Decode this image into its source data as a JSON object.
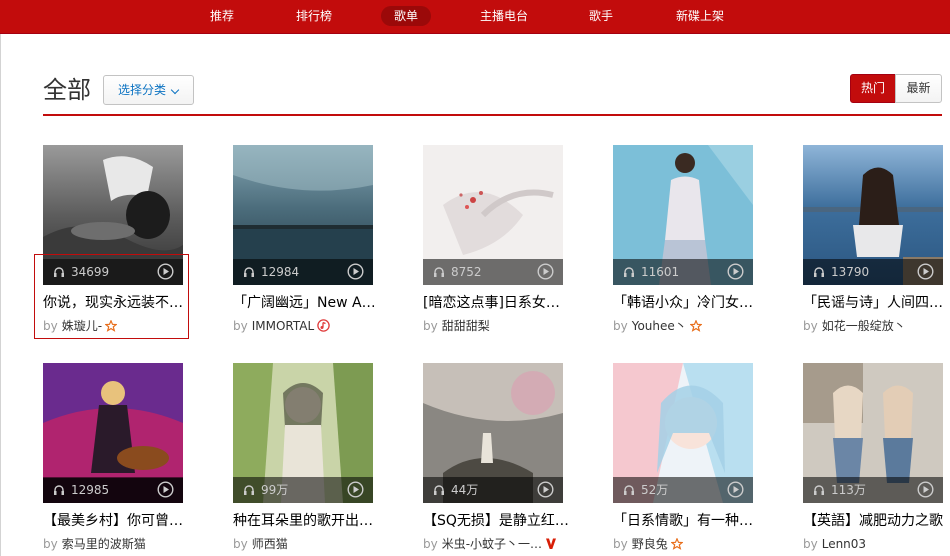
{
  "nav": {
    "items": [
      {
        "label": "推荐"
      },
      {
        "label": "排行榜"
      },
      {
        "label": "歌单"
      },
      {
        "label": "主播电台"
      },
      {
        "label": "歌手"
      },
      {
        "label": "新碟上架"
      }
    ],
    "active_index": 2
  },
  "header": {
    "title": "全部",
    "category_button": "选择分类",
    "sort_hot": "热门",
    "sort_new": "最新"
  },
  "playlists": [
    {
      "title": "你说，现实永远装不…",
      "plays": "34699",
      "author": "姝璇儿-",
      "badge": "star-icon"
    },
    {
      "title": "「广阔幽远」New A…",
      "plays": "12984",
      "author": "IMMORTAL",
      "badge": "music-note-badge-icon"
    },
    {
      "title": "[暗恋这点事]日系女…",
      "plays": "8752",
      "author": "甜甜甜梨",
      "badge": ""
    },
    {
      "title": "「韩语小众」冷门女…",
      "plays": "11601",
      "author": "Youhee丶",
      "badge": "star-icon"
    },
    {
      "title": "「民谣与诗」人间四…",
      "plays": "13790",
      "author": "如花一般绽放丶",
      "badge": ""
    },
    {
      "title": "【最美乡村】你可曾…",
      "plays": "12985",
      "author": "索马里的波斯猫",
      "badge": ""
    },
    {
      "title": "种在耳朵里的歌开出…",
      "plays": "99万",
      "author": "师西猫",
      "badge": ""
    },
    {
      "title": "【SQ无损】是静立红…",
      "plays": "44万",
      "author": "米虫-小蚊子丶一…",
      "badge": "verified-v-icon"
    },
    {
      "title": "「日系情歌」有一种…",
      "plays": "52万",
      "author": "野良兔",
      "badge": "star-icon"
    },
    {
      "title": "【英語】减肥动力之歌",
      "plays": "113万",
      "author": "Lenn03",
      "badge": ""
    }
  ],
  "by_label": "by",
  "colors": {
    "accent": "#c20c0c",
    "link": "#0c73c2",
    "star": "#e86e1b"
  }
}
